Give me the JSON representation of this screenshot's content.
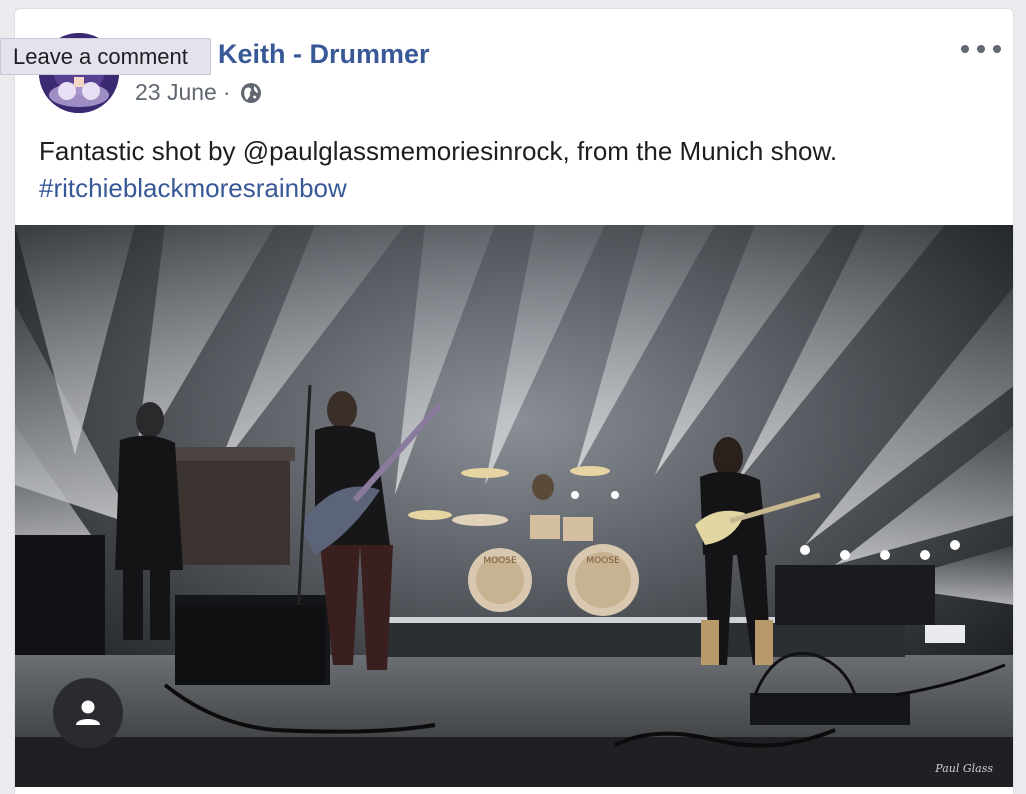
{
  "post": {
    "author_name": "Keith - Drummer",
    "date": "23 June",
    "separator": "·",
    "privacy_icon": "globe-icon",
    "text": "Fantastic shot by @paulglassmemoriesinrock, from the Munich show.",
    "hashtag": "#ritchieblackmoresrainbow",
    "more_icon": "more-options-icon"
  },
  "tooltip": {
    "label": "Leave a comment"
  },
  "photo": {
    "kick_drum_logo": "MOOSE",
    "signature": "Paul Glass"
  },
  "colors": {
    "link": "#385898",
    "text": "#1c1e21",
    "meta": "#606770"
  }
}
